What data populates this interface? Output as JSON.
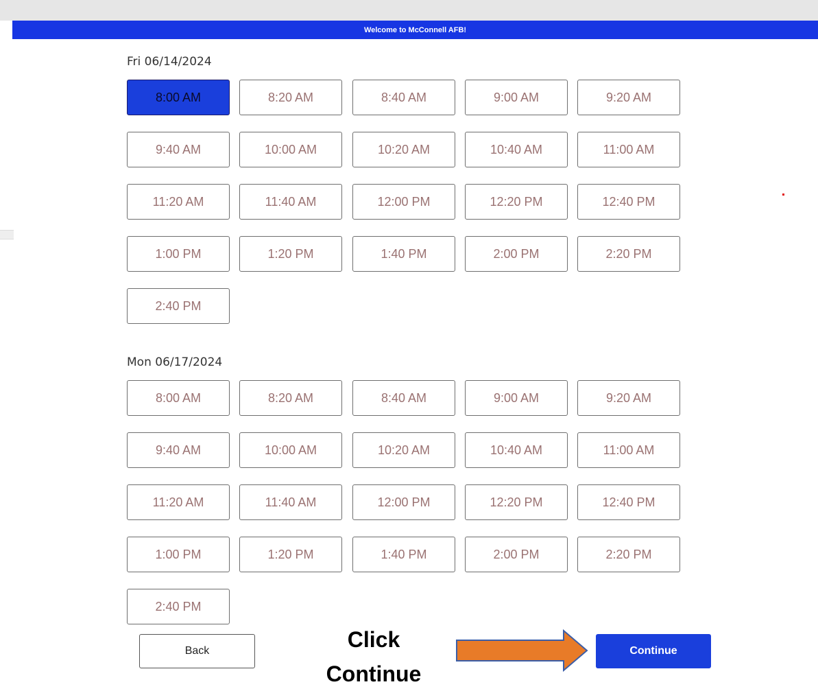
{
  "banner": {
    "text": "Welcome to McConnell AFB!"
  },
  "days": [
    {
      "date": "Fri 06/14/2024",
      "selected": "8:00 AM",
      "slots": [
        "8:00 AM",
        "8:20 AM",
        "8:40 AM",
        "9:00 AM",
        "9:20 AM",
        "9:40 AM",
        "10:00 AM",
        "10:20 AM",
        "10:40 AM",
        "11:00 AM",
        "11:20 AM",
        "11:40 AM",
        "12:00 PM",
        "12:20 PM",
        "12:40 PM",
        "1:00 PM",
        "1:20 PM",
        "1:40 PM",
        "2:00 PM",
        "2:20 PM",
        "2:40 PM"
      ]
    },
    {
      "date": "Mon 06/17/2024",
      "selected": "",
      "slots": [
        "8:00 AM",
        "8:20 AM",
        "8:40 AM",
        "9:00 AM",
        "9:20 AM",
        "9:40 AM",
        "10:00 AM",
        "10:20 AM",
        "10:40 AM",
        "11:00 AM",
        "11:20 AM",
        "11:40 AM",
        "12:00 PM",
        "12:20 PM",
        "12:40 PM",
        "1:00 PM",
        "1:20 PM",
        "1:40 PM",
        "2:00 PM",
        "2:20 PM",
        "2:40 PM"
      ]
    }
  ],
  "buttons": {
    "back": "Back",
    "continue": "Continue"
  },
  "annotation": {
    "line1": "Click",
    "line2": "Continue",
    "arrow_color": "#e87b28"
  },
  "colors": {
    "accent": "#1a3fdc",
    "banner": "#1736e3",
    "slot_text": "#9a7272"
  }
}
